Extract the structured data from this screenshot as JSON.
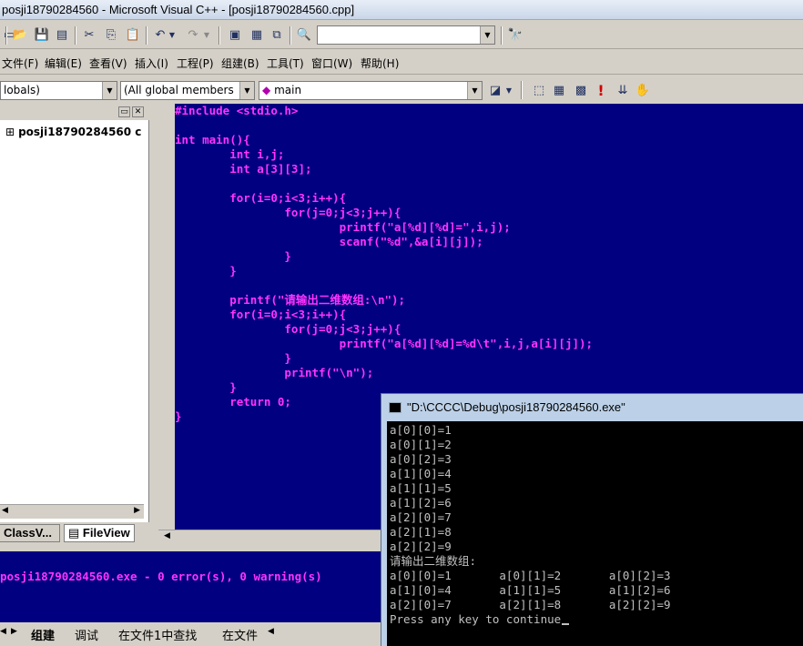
{
  "window": {
    "title": "posji18790284560 - Microsoft Visual C++ - [posji18790284560.cpp]"
  },
  "toolbar": {
    "find_combo_value": ""
  },
  "menu": [
    {
      "label": "文件(F)"
    },
    {
      "label": "编辑(E)"
    },
    {
      "label": "查看(V)"
    },
    {
      "label": "插入(I)"
    },
    {
      "label": "工程(P)"
    },
    {
      "label": "组建(B)"
    },
    {
      "label": "工具(T)"
    },
    {
      "label": "窗口(W)"
    },
    {
      "label": "帮助(H)"
    }
  ],
  "wizard": {
    "scope": "lobals)",
    "members": "(All global members",
    "function": "main"
  },
  "workspace": {
    "project": "posji18790284560 c",
    "tabs": [
      {
        "label": "ClassV..."
      },
      {
        "label": "FileView"
      }
    ]
  },
  "editor": {
    "lines": [
      {
        "text": "#include <stdio.h>"
      },
      {
        "text": ""
      },
      {
        "text": "int main(){"
      },
      {
        "text": "        int i,j;"
      },
      {
        "text": "        int a[3][3];"
      },
      {
        "text": ""
      },
      {
        "text": "        for(i=0;i<3;i++){"
      },
      {
        "text": "                for(j=0;j<3;j++){"
      },
      {
        "text": "                        printf(\"a[%d][%d]=\",i,j);"
      },
      {
        "text": "                        scanf(\"%d\",&a[i][j]);"
      },
      {
        "text": "                }"
      },
      {
        "text": "        }"
      },
      {
        "text": ""
      },
      {
        "text": "        printf(\"请输出二维数组:\\n\");"
      },
      {
        "text": "        for(i=0;i<3;i++){"
      },
      {
        "text": "                for(j=0;j<3;j++){"
      },
      {
        "text": "                        printf(\"a[%d][%d]=%d\\t\",i,j,a[i][j]);"
      },
      {
        "text": "                }"
      },
      {
        "text": "                printf(\"\\n\");"
      },
      {
        "text": "        }"
      },
      {
        "text": "        return 0;"
      },
      {
        "text": "}"
      }
    ]
  },
  "output": {
    "message": "posji18790284560.exe - 0 error(s), 0 warning(s)",
    "tabs": [
      {
        "label": "组建"
      },
      {
        "label": "调试"
      },
      {
        "label": "在文件1中查找"
      },
      {
        "label": "在文件"
      }
    ]
  },
  "console": {
    "title": "\"D:\\CCCC\\Debug\\posji18790284560.exe\"",
    "lines": [
      {
        "text": "a[0][0]=1"
      },
      {
        "text": "a[0][1]=2"
      },
      {
        "text": "a[0][2]=3"
      },
      {
        "text": "a[1][0]=4"
      },
      {
        "text": "a[1][1]=5"
      },
      {
        "text": "a[1][2]=6"
      },
      {
        "text": "a[2][0]=7"
      },
      {
        "text": "a[2][1]=8"
      },
      {
        "text": "a[2][2]=9"
      },
      {
        "text": "请输出二维数组:"
      },
      {
        "text": "a[0][0]=1       a[0][1]=2       a[0][2]=3"
      },
      {
        "text": "a[1][0]=4       a[1][1]=5       a[1][2]=6"
      },
      {
        "text": "a[2][0]=7       a[2][1]=8       a[2][2]=9"
      },
      {
        "text": "Press any key to continue"
      }
    ]
  }
}
